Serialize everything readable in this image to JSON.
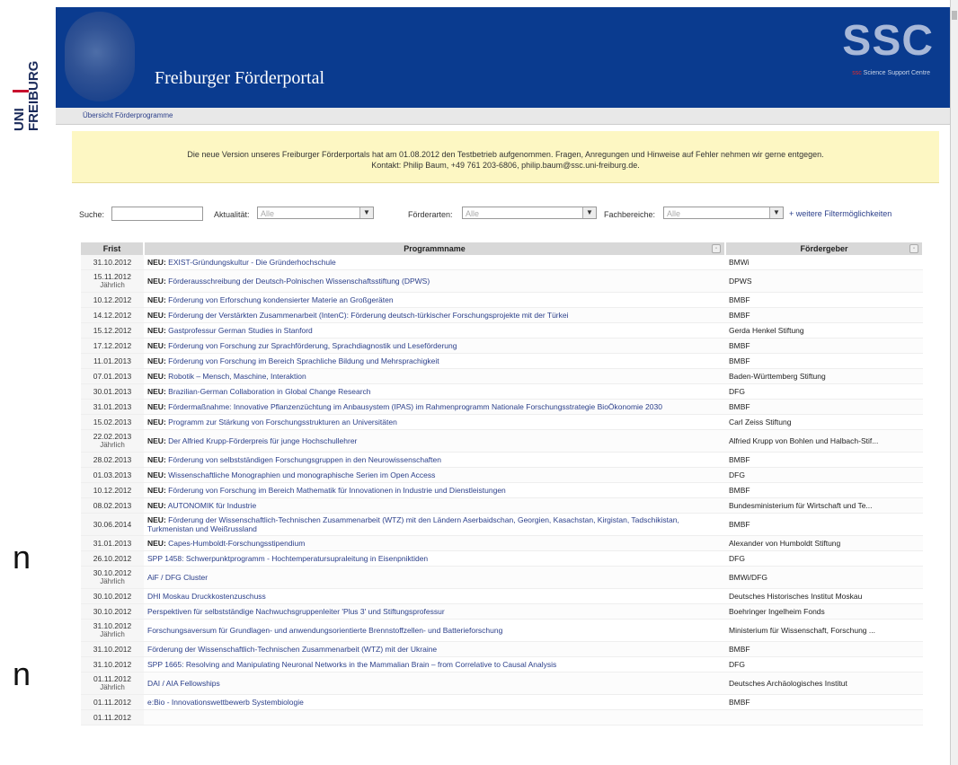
{
  "logo": {
    "line1": "UNI",
    "line2": "FREIBURG"
  },
  "slide_fragments": [
    "n",
    "n"
  ],
  "header": {
    "title": "Freiburger Förderportal",
    "ssc": "SSC",
    "ssc_sub_red": "ssc",
    "ssc_sub": "Science Support Centre"
  },
  "subnav": {
    "label": "Übersicht Förderprogramme"
  },
  "notice": {
    "line1": "Die neue Version unseres Freiburger Förderportals hat am 01.08.2012 den Testbetrieb aufgenommen. Fragen, Anregungen und Hinweise auf Fehler nehmen wir gerne entgegen.",
    "line2": "Kontakt: Philip Baum, +49 761 203-6806, philip.baum@ssc.uni-freiburg.de."
  },
  "filters": {
    "search_label": "Suche:",
    "aktualitaet_label": "Aktualität:",
    "aktualitaet_value": "Alle",
    "foerderarten_label": "Förderarten:",
    "foerderarten_value": "Alle",
    "fachbereiche_label": "Fachbereiche:",
    "fachbereiche_value": "Alle",
    "more": "+ weitere Filtermöglichkeiten"
  },
  "table": {
    "headers": [
      "Frist",
      "Programmname",
      "Fördergeber"
    ],
    "rows": [
      {
        "frist": "31.10.2012",
        "sub": "",
        "neu": "NEU:",
        "name": "EXIST-Gründungskultur - Die Gründerhochschule",
        "geber": "BMWi"
      },
      {
        "frist": "15.11.2012",
        "sub": "Jährlich",
        "neu": "NEU:",
        "name": "Förderausschreibung der Deutsch-Polnischen Wissenschaftsstiftung (DPWS)",
        "geber": "DPWS"
      },
      {
        "frist": "10.12.2012",
        "sub": "",
        "neu": "NEU:",
        "name": "Förderung von Erforschung kondensierter Materie an Großgeräten",
        "geber": "BMBF"
      },
      {
        "frist": "14.12.2012",
        "sub": "",
        "neu": "NEU:",
        "name": "Förderung der Verstärkten Zusammenarbeit (IntenC): Förderung deutsch-türkischer Forschungsprojekte mit der Türkei",
        "geber": "BMBF"
      },
      {
        "frist": "15.12.2012",
        "sub": "",
        "neu": "NEU:",
        "name": "Gastprofessur German Studies in Stanford",
        "geber": "Gerda Henkel Stiftung"
      },
      {
        "frist": "17.12.2012",
        "sub": "",
        "neu": "NEU:",
        "name": "Förderung von Forschung zur Sprachförderung, Sprachdiagnostik und Leseförderung",
        "geber": "BMBF"
      },
      {
        "frist": "11.01.2013",
        "sub": "",
        "neu": "NEU:",
        "name": "Förderung von Forschung im Bereich Sprachliche Bildung und Mehrsprachigkeit",
        "geber": "BMBF"
      },
      {
        "frist": "07.01.2013",
        "sub": "",
        "neu": "NEU:",
        "name": "Robotik – Mensch, Maschine, Interaktion",
        "geber": "Baden-Württemberg Stiftung"
      },
      {
        "frist": "30.01.2013",
        "sub": "",
        "neu": "NEU:",
        "name": "Brazilian-German Collaboration in Global Change Research",
        "geber": "DFG"
      },
      {
        "frist": "31.01.2013",
        "sub": "",
        "neu": "NEU:",
        "name": "Fördermaßnahme: Innovative Pflanzenzüchtung im Anbausystem (IPAS) im Rahmenprogramm Nationale Forschungsstrategie BioÖkonomie 2030",
        "geber": "BMBF"
      },
      {
        "frist": "15.02.2013",
        "sub": "",
        "neu": "NEU:",
        "name": "Programm zur Stärkung von Forschungsstrukturen an Universitäten",
        "geber": "Carl Zeiss Stiftung"
      },
      {
        "frist": "22.02.2013",
        "sub": "Jährlich",
        "neu": "NEU:",
        "name": "Der Alfried Krupp-Förderpreis für junge Hochschullehrer",
        "geber": "Alfried Krupp von Bohlen und Halbach-Stif..."
      },
      {
        "frist": "28.02.2013",
        "sub": "",
        "neu": "NEU:",
        "name": "Förderung von selbstständigen Forschungsgruppen in den Neurowissenschaften",
        "geber": "BMBF"
      },
      {
        "frist": "01.03.2013",
        "sub": "",
        "neu": "NEU:",
        "name": "Wissenschaftliche Monographien und monographische Serien im Open Access",
        "geber": "DFG"
      },
      {
        "frist": "10.12.2012",
        "sub": "",
        "neu": "NEU:",
        "name": "Förderung von Forschung im Bereich Mathematik für Innovationen in Industrie und Dienstleistungen",
        "geber": "BMBF"
      },
      {
        "frist": "08.02.2013",
        "sub": "",
        "neu": "NEU:",
        "name": "AUTONOMIK für Industrie",
        "geber": "Bundesministerium für Wirtschaft und Te..."
      },
      {
        "frist": "30.06.2014",
        "sub": "",
        "neu": "NEU:",
        "name": "Förderung der Wissenschaftlich-Technischen Zusammenarbeit (WTZ) mit den Ländern Aserbaidschan, Georgien, Kasachstan, Kirgistan, Tadschikistan, Turkmenistan und Weißrussland",
        "geber": "BMBF"
      },
      {
        "frist": "31.01.2013",
        "sub": "",
        "neu": "NEU:",
        "name": "Capes-Humboldt-Forschungsstipendium",
        "geber": "Alexander von Humboldt Stiftung"
      },
      {
        "frist": "26.10.2012",
        "sub": "",
        "neu": "",
        "name": "SPP 1458: Schwerpunktprogramm - Hochtemperatursupraleitung in Eisenpniktiden",
        "geber": "DFG"
      },
      {
        "frist": "30.10.2012",
        "sub": "Jährlich",
        "neu": "",
        "name": "AiF / DFG Cluster",
        "geber": "BMWi/DFG"
      },
      {
        "frist": "30.10.2012",
        "sub": "",
        "neu": "",
        "name": "DHI Moskau Druckkostenzuschuss",
        "geber": "Deutsches Historisches Institut Moskau"
      },
      {
        "frist": "30.10.2012",
        "sub": "",
        "neu": "",
        "name": "Perspektiven für selbstständige Nachwuchsgruppenleiter 'Plus 3' und Stiftungsprofessur",
        "geber": "Boehringer Ingelheim Fonds"
      },
      {
        "frist": "31.10.2012",
        "sub": "Jährlich",
        "neu": "",
        "name": "Forschungsaversum für Grundlagen- und anwendungsorientierte Brennstoffzellen- und Batterieforschung",
        "geber": "Ministerium für Wissenschaft, Forschung ..."
      },
      {
        "frist": "31.10.2012",
        "sub": "",
        "neu": "",
        "name": "Förderung der Wissenschaftlich-Technischen Zusammenarbeit (WTZ) mit der Ukraine",
        "geber": "BMBF"
      },
      {
        "frist": "31.10.2012",
        "sub": "",
        "neu": "",
        "name": "SPP 1665: Resolving and Manipulating Neuronal Networks in the Mammalian Brain – from Correlative to Causal Analysis",
        "geber": "DFG"
      },
      {
        "frist": "01.11.2012",
        "sub": "Jährlich",
        "neu": "",
        "name": "DAI / AIA Fellowships",
        "geber": "Deutsches Archäologisches Institut"
      },
      {
        "frist": "01.11.2012",
        "sub": "",
        "neu": "",
        "name": "e:Bio - Innovationswettbewerb Systembiologie",
        "geber": "BMBF"
      },
      {
        "frist": "01.11.2012",
        "sub": "",
        "neu": "",
        "name": "",
        "geber": ""
      }
    ]
  }
}
